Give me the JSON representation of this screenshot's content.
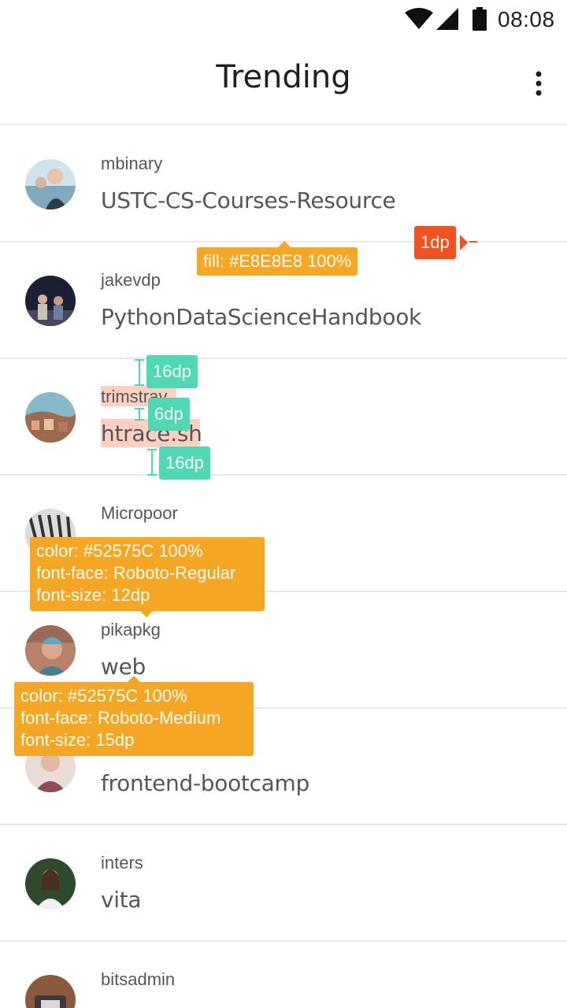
{
  "status": {
    "time": "08:08"
  },
  "appbar": {
    "title": "Trending"
  },
  "repos": [
    {
      "owner": "mbinary",
      "name": "USTC-CS-Courses-Resource"
    },
    {
      "owner": "jakevdp",
      "name": "PythonDataScienceHandbook"
    },
    {
      "owner": "trimstray",
      "name": "htrace.sh"
    },
    {
      "owner": "Micropoor",
      "name": ""
    },
    {
      "owner": "pikapkg",
      "name": "web"
    },
    {
      "owner": "",
      "name": "frontend-bootcamp"
    },
    {
      "owner": "inters",
      "name": "vita"
    },
    {
      "owner": "bitsadmin",
      "name": ""
    }
  ],
  "annotations": {
    "divider_fill": "fill: #E8E8E8 100%",
    "divider_size": "1dp",
    "spacing_top": "16dp",
    "spacing_mid": "6dp",
    "spacing_bottom": "16dp",
    "owner_spec": {
      "line1": "color: #52575C 100%",
      "line2": "font-face: Roboto-Regular",
      "line3": "font-size: 12dp"
    },
    "repo_spec": {
      "line1": "color: #52575C 100%",
      "line2": "font-face: Roboto-Medium",
      "line3": "font-size: 15dp"
    }
  },
  "colors": {
    "text": "#52575C",
    "divider": "#E8E8E8",
    "tooltip": "#F5A623",
    "spacing_badge": "#4FD8B4",
    "size_badge": "#F4511E"
  },
  "icons": [
    "wifi-icon",
    "signal-icon",
    "battery-icon",
    "more-vert-icon"
  ]
}
